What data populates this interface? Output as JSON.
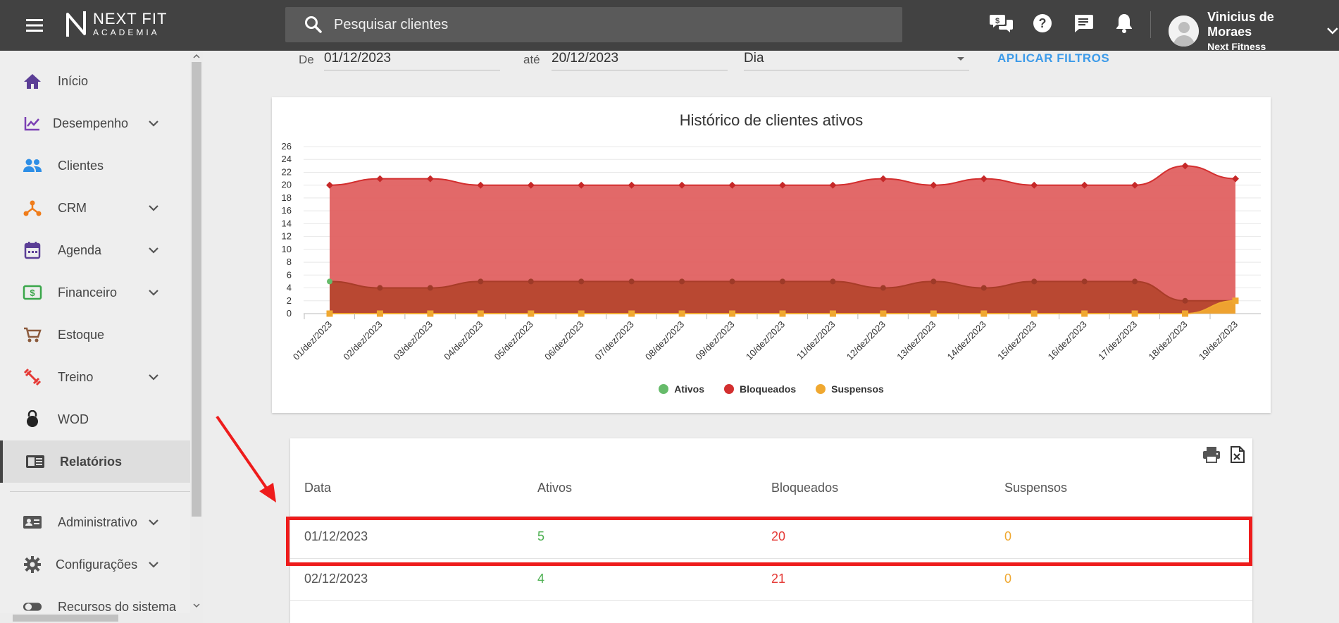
{
  "header": {
    "logo_line1": "NEXT FIT",
    "logo_line2": "ACADEMIA",
    "search_placeholder": "Pesquisar clientes",
    "user_name": "Vinicius de Moraes",
    "user_company": "Next Fitness",
    "icons": [
      "menu-icon",
      "chat-money-icon",
      "help-icon",
      "message-icon",
      "bell-icon",
      "avatar",
      "chevron-down-icon"
    ]
  },
  "sidebar": {
    "items": [
      {
        "label": "Início",
        "icon": "home-icon",
        "color": "#5b3e96",
        "expandable": false
      },
      {
        "label": "Desempenho",
        "icon": "chart-line-icon",
        "color": "#7b3fb3",
        "expandable": true
      },
      {
        "label": "Clientes",
        "icon": "people-icon",
        "color": "#2d8ee6",
        "expandable": false
      },
      {
        "label": "CRM",
        "icon": "crm-icon",
        "color": "#ef7c1a",
        "expandable": true
      },
      {
        "label": "Agenda",
        "icon": "calendar-icon",
        "color": "#5b3e96",
        "expandable": true
      },
      {
        "label": "Financeiro",
        "icon": "money-icon",
        "color": "#3aa64a",
        "expandable": true
      },
      {
        "label": "Estoque",
        "icon": "cart-icon",
        "color": "#8b5a3c",
        "expandable": false
      },
      {
        "label": "Treino",
        "icon": "dumbbell-icon",
        "color": "#e53935",
        "expandable": true
      },
      {
        "label": "WOD",
        "icon": "kettlebell-icon",
        "color": "#222222",
        "expandable": false
      },
      {
        "label": "Relatórios",
        "icon": "report-icon",
        "color": "#444444",
        "expandable": false,
        "active": true
      },
      {
        "label": "Administrativo",
        "icon": "id-card-icon",
        "color": "#555555",
        "expandable": true
      },
      {
        "label": "Configurações",
        "icon": "gear-icon",
        "color": "#555555",
        "expandable": true
      },
      {
        "label": "Recursos do sistema",
        "icon": "toggle-icon",
        "color": "#555555",
        "expandable": false
      }
    ]
  },
  "filters": {
    "from_label": "De",
    "from_value": "01/12/2023",
    "to_label": "até",
    "to_value": "20/12/2023",
    "period_value": "Dia",
    "apply_label": "APLICAR FILTROS"
  },
  "chart_data": {
    "type": "area",
    "title": "Histórico de clientes ativos",
    "categories": [
      "01/dez/2023",
      "02/dez/2023",
      "03/dez/2023",
      "04/dez/2023",
      "05/dez/2023",
      "06/dez/2023",
      "07/dez/2023",
      "08/dez/2023",
      "09/dez/2023",
      "10/dez/2023",
      "11/dez/2023",
      "12/dez/2023",
      "13/dez/2023",
      "14/dez/2023",
      "15/dez/2023",
      "16/dez/2023",
      "17/dez/2023",
      "18/dez/2023",
      "19/dez/2023"
    ],
    "yticks": [
      0,
      2,
      4,
      6,
      8,
      10,
      12,
      14,
      16,
      18,
      20,
      22,
      24,
      26
    ],
    "ylim": [
      0,
      26
    ],
    "grid": true,
    "legend_position": "bottom",
    "series": [
      {
        "name": "Ativos",
        "color": "#66bb6a",
        "values": [
          5,
          4,
          4,
          5,
          5,
          5,
          5,
          5,
          5,
          5,
          5,
          4,
          5,
          4,
          5,
          5,
          5,
          2,
          2
        ]
      },
      {
        "name": "Bloqueados",
        "color": "#d32f2f",
        "values": [
          20,
          21,
          21,
          20,
          20,
          20,
          20,
          20,
          20,
          20,
          20,
          21,
          20,
          21,
          20,
          20,
          20,
          23,
          21
        ]
      },
      {
        "name": "Suspensos",
        "color": "#f0a830",
        "values": [
          0,
          0,
          0,
          0,
          0,
          0,
          0,
          0,
          0,
          0,
          0,
          0,
          0,
          0,
          0,
          0,
          0,
          0,
          2
        ]
      }
    ]
  },
  "table": {
    "headers": {
      "date": "Data",
      "ativos": "Ativos",
      "bloqueados": "Bloqueados",
      "suspensos": "Suspensos"
    },
    "rows": [
      {
        "date": "01/12/2023",
        "ativos": "5",
        "bloqueados": "20",
        "suspensos": "0"
      },
      {
        "date": "02/12/2023",
        "ativos": "4",
        "bloqueados": "21",
        "suspensos": "0"
      }
    ],
    "actions": [
      "print-icon",
      "excel-icon"
    ]
  }
}
